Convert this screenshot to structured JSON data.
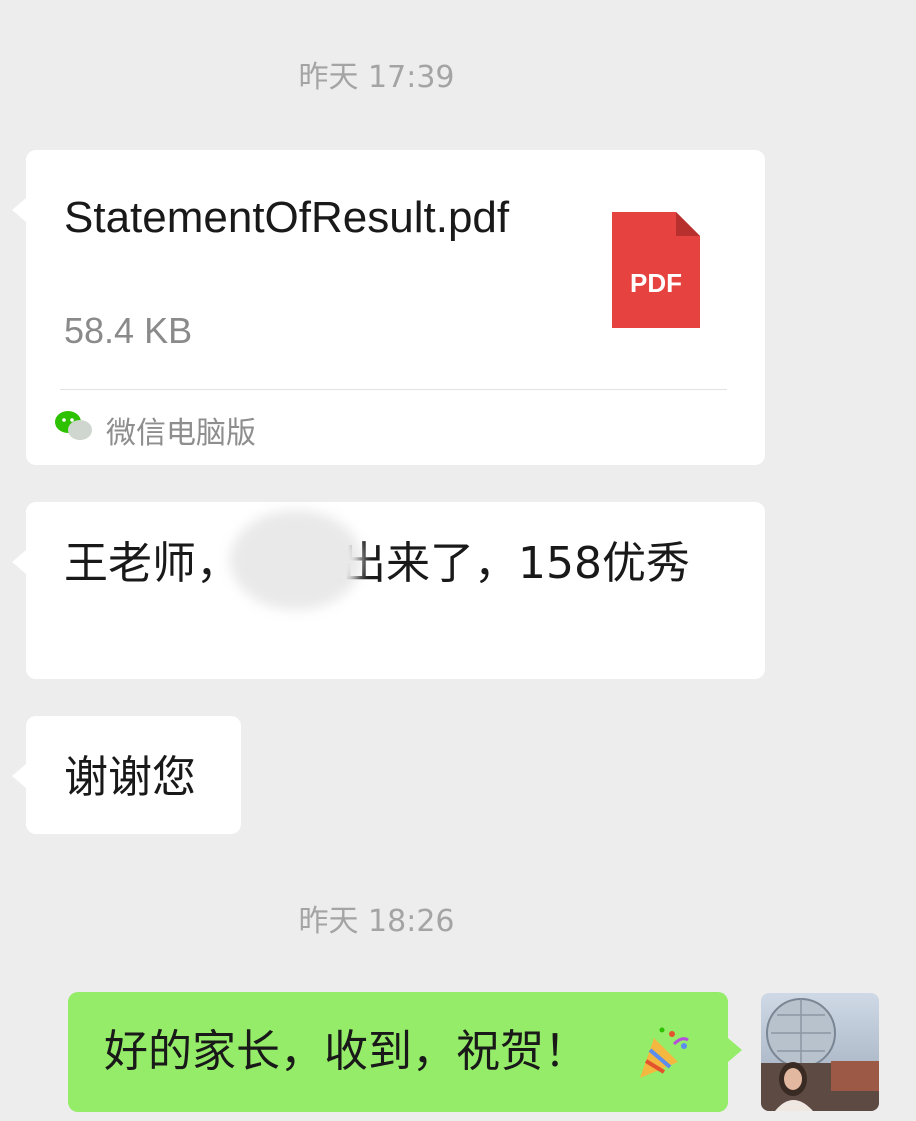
{
  "timestamps": {
    "first": "昨天 17:39",
    "second": "昨天 18:26"
  },
  "file_message": {
    "file_name": "StatementOfResult.pdf",
    "file_size": "58.4 KB",
    "file_type_label": "PDF",
    "source_label": "微信电脑版",
    "icon": "pdf-file-icon",
    "source_icon": "wechat-icon"
  },
  "messages": [
    {
      "side": "left",
      "text": "王老师，       成绩出来了，158优秀"
    },
    {
      "side": "left",
      "text": "谢谢您"
    },
    {
      "side": "right",
      "text": "好的家长，收到，祝贺！"
    }
  ],
  "colors": {
    "background": "#ededed",
    "incoming_bubble": "#ffffff",
    "outgoing_bubble": "#95ec69",
    "pdf_red": "#e64340",
    "timestamp": "#a4a4a4"
  },
  "avatar": {
    "icon": "user-avatar"
  }
}
